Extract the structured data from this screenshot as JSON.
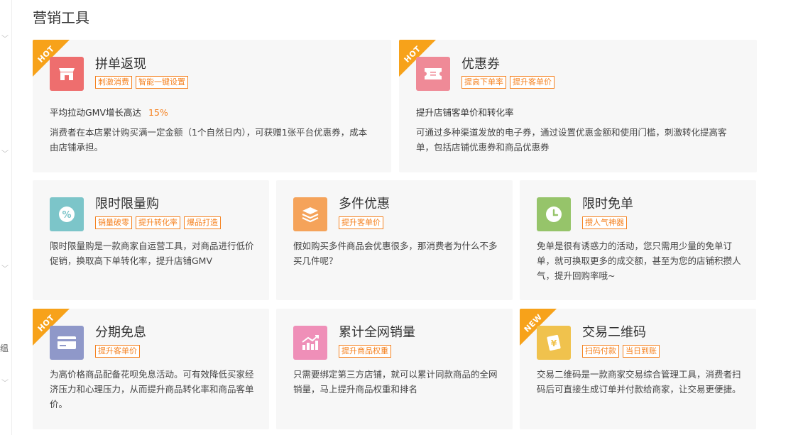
{
  "page": {
    "title": "营销工具"
  },
  "left_rail": {
    "partial_char": "缊"
  },
  "cards": [
    {
      "title": "拼单返现",
      "badge": "HOT",
      "icon": "store-icon",
      "icon_color": "#ee6e6e",
      "tags": [
        "刺激消费",
        "智能一键设置"
      ],
      "stat_text": "平均拉动GMV增长高达",
      "stat_value": "15%",
      "description": "消费者在本店累计购买满一定金额（1个自然日内），可获赠1张平台优惠券，成本由店铺承担。"
    },
    {
      "title": "优惠券",
      "badge": "HOT",
      "icon": "coupon-icon",
      "icon_color": "#ef8a97",
      "tags": [
        "提高下单率",
        "提升客单价"
      ],
      "stat_text": "提升店铺客单价和转化率",
      "description": "可通过多种渠道发放的电子券，通过设置优惠金额和使用门槛，刺激转化提高客单，包括店铺优惠券和商品优惠券"
    },
    {
      "title": "限时限量购",
      "icon": "percent-badge-icon",
      "icon_color": "#7cc5c9",
      "tags": [
        "销量破零",
        "提升转化率",
        "爆品打造"
      ],
      "description": "限时限量购是一款商家自运营工具，对商品进行低价促销，换取高下单转化率，提升店铺GMV"
    },
    {
      "title": "多件优惠",
      "icon": "layers-icon",
      "icon_color": "#f5a35a",
      "tags": [
        "提升客单价"
      ],
      "description": "假如购买多件商品会优惠很多，那消费者为什么不多买几件呢？"
    },
    {
      "title": "限时免单",
      "icon": "clock-icon",
      "icon_color": "#96c46a",
      "tags": [
        "攒人气神器"
      ],
      "description": "免单是很有诱惑力的活动，您只需用少量的免单订单，就可换取更多的成交额，甚至为您的店铺积攒人气，提升回购率哦~"
    },
    {
      "title": "分期免息",
      "badge": "HOT",
      "icon": "credit-card-icon",
      "icon_color": "#8f98c9",
      "tags": [
        "提升客单价"
      ],
      "description": "为高价格商品配备花呗免息活动。可有效降低买家经济压力和心理压力，从而提升商品转化率和商品客单价。"
    },
    {
      "title": "累计全网销量",
      "icon": "growth-chart-icon",
      "icon_color": "#ef8fb8",
      "tags": [
        "提升商品权重"
      ],
      "description": "只需要绑定第三方店铺，就可以累计同款商品的全网销量，马上提升商品权重和排名"
    },
    {
      "title": "交易二维码",
      "badge": "NEW",
      "icon": "qr-payment-icon",
      "icon_color": "#f0c24d",
      "tags": [
        "扫码付款",
        "当日到账"
      ],
      "description": "交易二维码是一款商家交易综合管理工具，消费者扫码后可直接生成订单并付款给商家，让交易更便捷。"
    }
  ]
}
